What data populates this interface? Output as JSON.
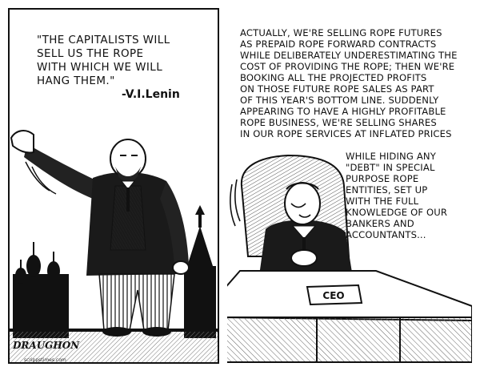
{
  "left_panel": {
    "quote": "\"The capitalists will\nsell us the rope\nwith which we will\nhang them.\"",
    "attribution": "-V.I.Lenin"
  },
  "right_panel": {
    "monologue_top": "Actually, we're selling rope futures\nas prepaid rope forward contracts\nwhile deliberately underestimating the\ncost of providing the rope; then we're\nbooking all the projected profits\non those future rope sales as part\nof this year's bottom line. Suddenly\nappearing to have a highly profitable\nrope business, we're selling shares\nin our rope services at inflated prices",
    "monologue_bottom": "while hiding any\n\"debt\" in special\npurpose rope\nentities, set up\nwith the full\nknowledge of our\nbankers and\naccountants...",
    "desk_sign": "CEO"
  },
  "signature": {
    "name": "DRAUGHON",
    "sub": "scrippstimes.com"
  }
}
